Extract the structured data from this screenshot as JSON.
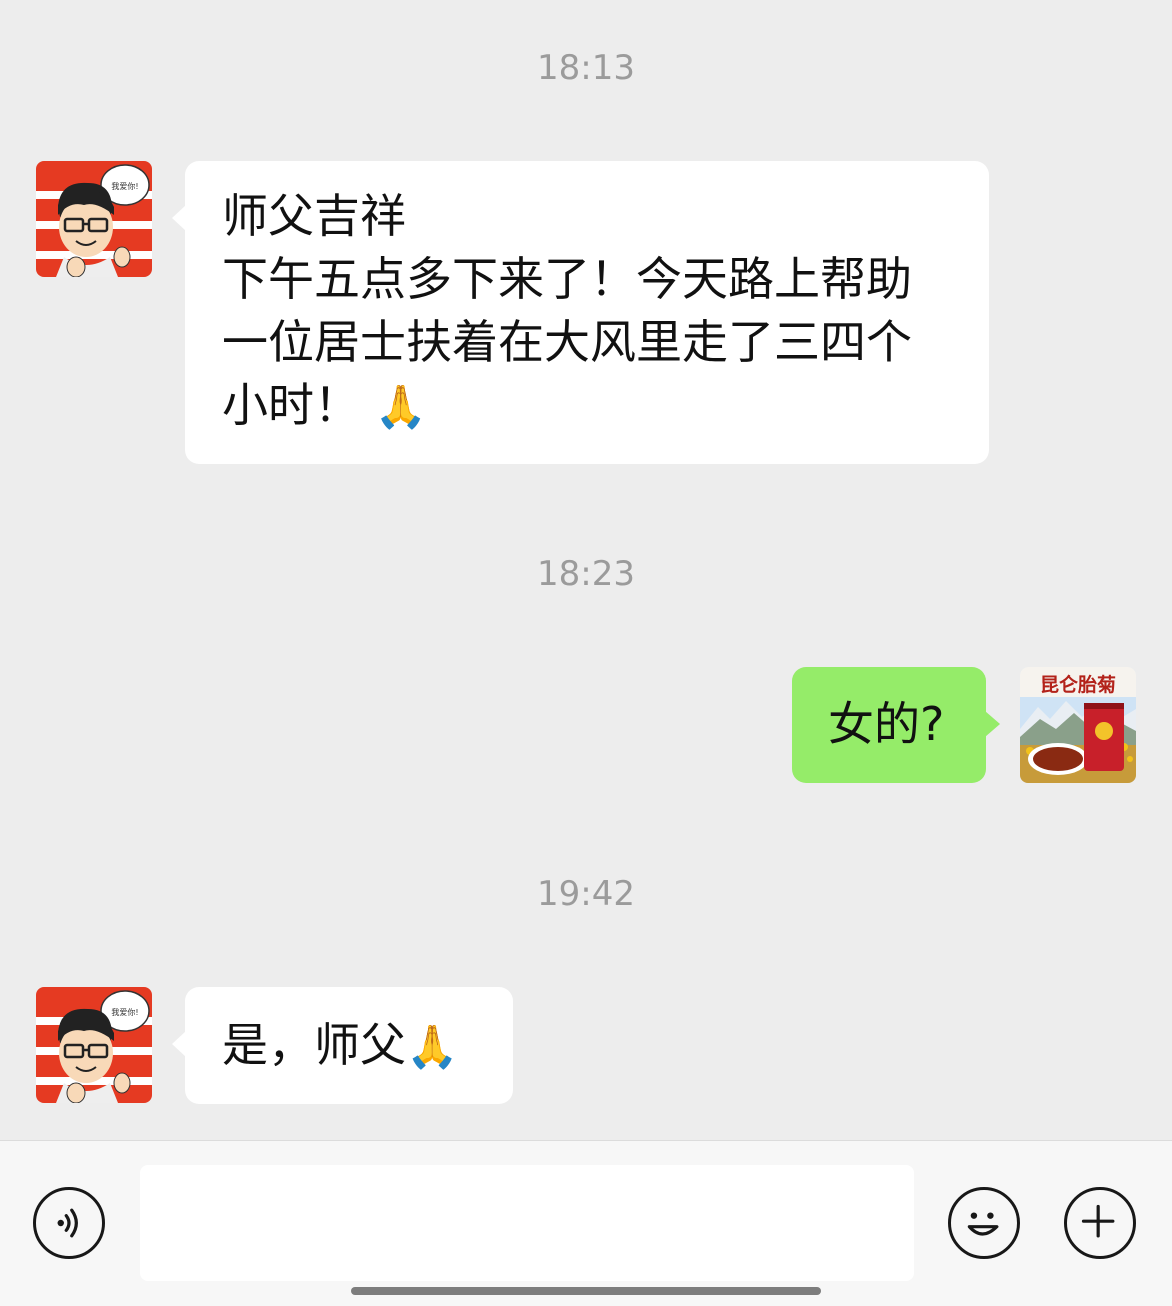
{
  "timestamps": [
    "18:13",
    "18:23",
    "19:42"
  ],
  "messages": [
    {
      "direction": "incoming",
      "sender_avatar_icon": "cartoon-man-avatar-icon",
      "avatar_caption": "我爱你!",
      "lines": [
        "师父吉祥",
        "下午五点多下来了！今天路上帮助",
        "一位居士扶着在大风里走了三四个",
        "小时！"
      ],
      "emoji": "🙏"
    },
    {
      "direction": "outgoing",
      "sender_avatar_icon": "tea-product-avatar-icon",
      "avatar_caption": "昆仑胎菊",
      "text": "女的?"
    },
    {
      "direction": "incoming",
      "sender_avatar_icon": "cartoon-man-avatar-icon",
      "avatar_caption": "我爱你!",
      "text": "是，师父",
      "emoji": "🙏"
    }
  ],
  "input_bar": {
    "voice_icon": "voice-icon",
    "emoji_icon": "smiley-icon",
    "plus_icon": "plus-icon",
    "input_value": ""
  },
  "colors": {
    "background": "#ededed",
    "incoming_bubble": "#ffffff",
    "outgoing_bubble": "#95ec69",
    "timestamp": "#9b9b9b"
  }
}
